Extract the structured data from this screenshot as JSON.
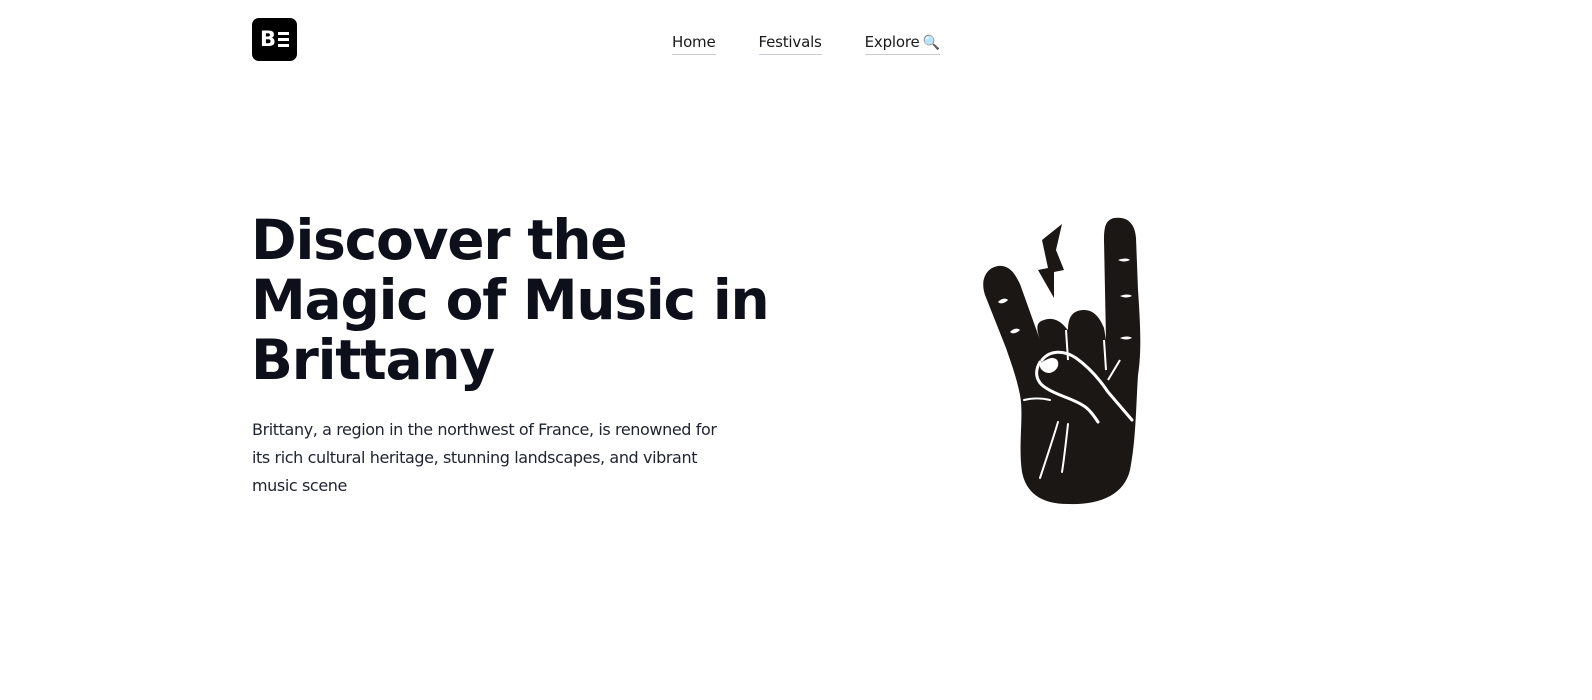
{
  "header": {
    "logo": {
      "letter": "B",
      "icon": "logo-bars-icon"
    },
    "nav": [
      {
        "label": "Home"
      },
      {
        "label": "Festivals"
      },
      {
        "label": "Explore",
        "icon": "search-icon",
        "icon_glyph": "🔍"
      }
    ]
  },
  "hero": {
    "title": "Discover the Magic of Music in Brittany",
    "description": "Brittany, a region in the northwest of France, is renowned for its rich cultural heritage, stunning landscapes, and vibrant music scene",
    "illustration": "rock-hand-icon"
  },
  "colors": {
    "background": "#ffffff",
    "text": "#0d0f1a",
    "logo_bg": "#000000",
    "illustration": "#1b1714"
  }
}
